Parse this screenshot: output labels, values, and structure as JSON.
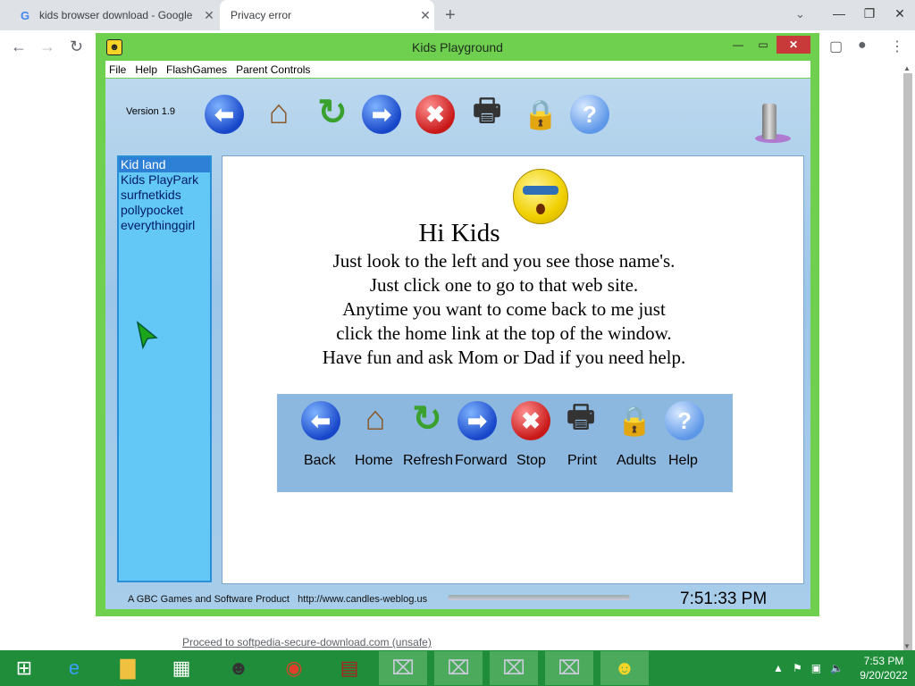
{
  "browser": {
    "tabs": [
      {
        "title": "kids browser download - Google",
        "favicon": "G"
      },
      {
        "title": "Privacy error"
      }
    ],
    "new_tab": "+"
  },
  "app": {
    "title": "Kids Playground",
    "menu": [
      "File",
      "Help",
      "FlashGames",
      "Parent Controls"
    ],
    "version": "Version 1.9",
    "sites": [
      "Kid land",
      "Kids PlayPark",
      "surfnetkids",
      "pollypocket",
      "everythinggirl"
    ],
    "content": {
      "greeting": "Hi Kids",
      "lines": [
        "Just look to the left and you see those name's.",
        "Just click one to go to that web site.",
        "Anytime you want to come back to me just",
        "click the home link at the top of the window.",
        "Have fun and ask Mom or Dad if you need help."
      ],
      "legend_labels": [
        "Back",
        "Home",
        "Refresh",
        "Forward",
        "Stop",
        "Print",
        "Adults",
        "Help"
      ]
    },
    "credit": "A GBC Games and Software Product",
    "url": "http://www.candles-weblog.us",
    "time": "7:51:33 PM"
  },
  "page": {
    "proceed_link": "Proceed to softpedia-secure-download.com (unsafe)"
  },
  "taskbar": {
    "clock_time": "7:53 PM",
    "clock_date": "9/20/2022"
  }
}
